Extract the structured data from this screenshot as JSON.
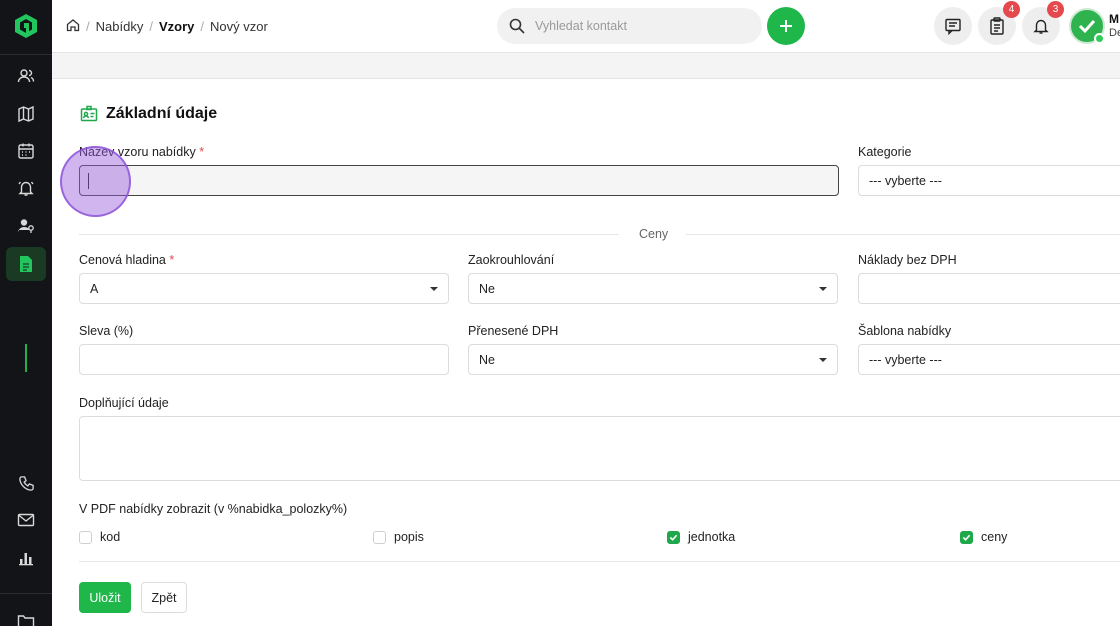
{
  "colors": {
    "accent": "#1fb74a",
    "badge": "#e5484d",
    "sidebar": "#121417"
  },
  "breadcrumb": {
    "home_icon": "home-icon",
    "items": [
      "Nabídky",
      "Vzory",
      "Nový vzor"
    ]
  },
  "search": {
    "placeholder": "Vyhledat kontakt"
  },
  "header": {
    "badges": {
      "tasks": "4",
      "notifications": "3"
    },
    "user": {
      "name": "M",
      "sub": "De"
    }
  },
  "sidebar": {
    "icons": [
      "contacts-icon",
      "map-icon",
      "calendar-icon",
      "bell-icon",
      "user-help-icon",
      "document-icon",
      "phone-icon",
      "mail-icon",
      "chart-icon",
      "folder-icon"
    ]
  },
  "form": {
    "section_title": "Základní údaje",
    "name_label": "Název vzoru nabídky",
    "name_value": "",
    "category_label": "Kategorie",
    "category_value": "--- vyberte ---",
    "prices_divider": "Ceny",
    "price_level_label": "Cenová hladina",
    "price_level_value": "A",
    "rounding_label": "Zaokrouhlování",
    "rounding_value": "Ne",
    "costs_label": "Náklady bez DPH",
    "costs_value": "",
    "discount_label": "Sleva (%)",
    "discount_value": "",
    "vat_label": "Přenesené DPH",
    "vat_value": "Ne",
    "template_label": "Šablona nabídky",
    "template_value": "--- vyberte ---",
    "notes_label": "Doplňující údaje",
    "notes_value": "",
    "pdf_label": "V PDF nabídky zobrazit (v %nabidka_polozky%)",
    "checkboxes": [
      {
        "label": "kod",
        "checked": false
      },
      {
        "label": "popis",
        "checked": false
      },
      {
        "label": "jednotka",
        "checked": true
      },
      {
        "label": "ceny",
        "checked": true
      }
    ],
    "save_label": "Uložit",
    "back_label": "Zpět"
  }
}
